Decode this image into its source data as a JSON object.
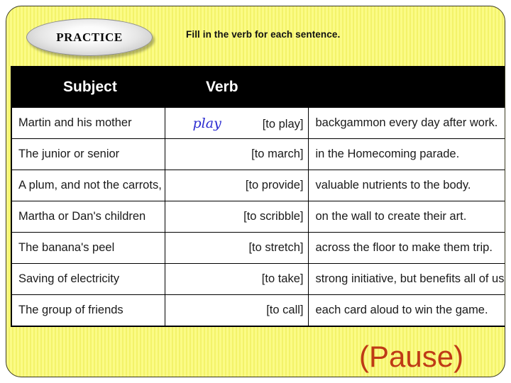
{
  "slide": {
    "badge_label": "PRACTICE",
    "instruction": "Fill in the verb for each sentence.",
    "pause_label": "(Pause)",
    "accent_yellow": "#fbfb86",
    "header_bg": "#000000",
    "header_fg": "#ffffff",
    "answer_color": "#2a2ad0",
    "pause_color": "#bf3a16"
  },
  "table": {
    "headers": {
      "subject": "Subject",
      "verb": "Verb",
      "rest": ""
    },
    "rows": [
      {
        "subject": "Martin and his mother",
        "answer": "play",
        "cue": "[to play]",
        "rest": "backgammon every day after work."
      },
      {
        "subject": "The junior or senior",
        "answer": "",
        "cue": "[to march]",
        "rest": "in the Homecoming parade."
      },
      {
        "subject": "A plum, and not the carrots,",
        "answer": "",
        "cue": "[to provide]",
        "rest": "valuable nutrients to the body."
      },
      {
        "subject": "Martha or Dan's children",
        "answer": "",
        "cue": "[to scribble]",
        "rest": "on the wall to create their art."
      },
      {
        "subject": "The banana's peel",
        "answer": "",
        "cue": "[to stretch]",
        "rest": "across the floor to make them trip."
      },
      {
        "subject": "Saving of electricity",
        "answer": "",
        "cue": "[to take]",
        "rest": "strong initiative, but benefits all of us."
      },
      {
        "subject": "The group of friends",
        "answer": "",
        "cue": "[to call]",
        "rest": "each card aloud to win the game."
      }
    ]
  }
}
